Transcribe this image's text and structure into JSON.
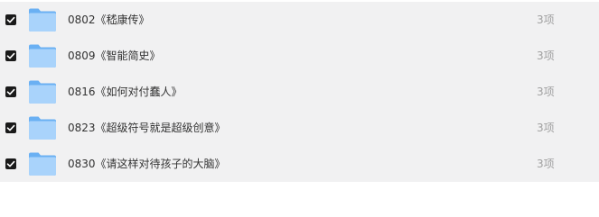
{
  "colors": {
    "row_background": "#f1f1f2",
    "checkbox": "#1a1a1a",
    "folder_light": "#a9d3fb",
    "folder_dark": "#6ab0f3",
    "count_text": "#a0a0a0"
  },
  "icons": {
    "checkbox": "checkbox-checked-icon",
    "folder": "folder-icon"
  },
  "files": [
    {
      "name": "0802《嵇康传》",
      "count": "3项",
      "checked": true
    },
    {
      "name": "0809《智能简史》",
      "count": "3项",
      "checked": true
    },
    {
      "name": "0816《如何对付蠢人》",
      "count": "3项",
      "checked": true
    },
    {
      "name": "0823《超级符号就是超级创意》",
      "count": "3项",
      "checked": true
    },
    {
      "name": "0830《请这样对待孩子的大脑》",
      "count": "3项",
      "checked": true
    }
  ]
}
